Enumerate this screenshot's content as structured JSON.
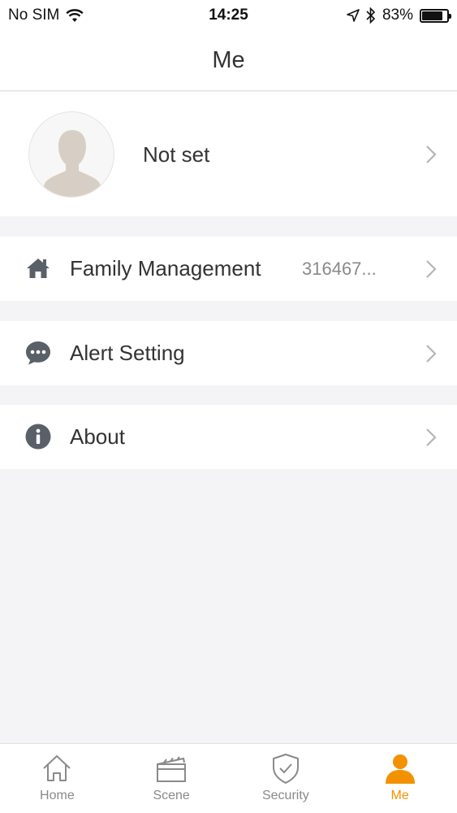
{
  "status_bar": {
    "carrier": "No SIM",
    "time": "14:25",
    "battery": "83%",
    "battery_level": 0.83
  },
  "nav": {
    "title": "Me"
  },
  "profile": {
    "name": "Not set"
  },
  "menu": [
    {
      "label": "Family Management",
      "value": "316467...",
      "icon": "home-icon"
    },
    {
      "label": "Alert Setting",
      "value": "",
      "icon": "chat-bubble-icon"
    },
    {
      "label": "About",
      "value": "",
      "icon": "info-icon"
    }
  ],
  "tabs": [
    {
      "label": "Home",
      "icon": "home-outline-icon",
      "active": false
    },
    {
      "label": "Scene",
      "icon": "clapperboard-icon",
      "active": false
    },
    {
      "label": "Security",
      "icon": "shield-check-icon",
      "active": false
    },
    {
      "label": "Me",
      "icon": "person-icon",
      "active": true
    }
  ],
  "colors": {
    "accent": "#f39200",
    "icon_gray": "#5a6068",
    "background": "#f4f4f6"
  }
}
